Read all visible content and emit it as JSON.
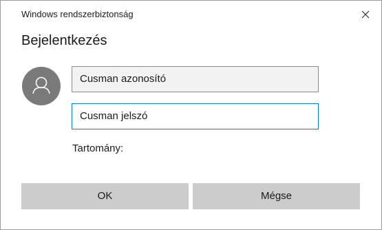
{
  "window": {
    "title": "Windows rendszerbiztonság",
    "close_icon": "close-icon"
  },
  "dialog": {
    "heading": "Bejelentkezés",
    "avatar_icon": "user-icon",
    "username": {
      "value": "Cusman azonosító"
    },
    "password": {
      "value": "Cusman jelszó"
    },
    "domain_label": "Tartomány:"
  },
  "buttons": {
    "ok_label": "OK",
    "cancel_label": "Mégse"
  },
  "colors": {
    "avatar_bg": "#7a7a7a",
    "focus_border": "#0a78d7",
    "button_bg": "#cccccc"
  }
}
